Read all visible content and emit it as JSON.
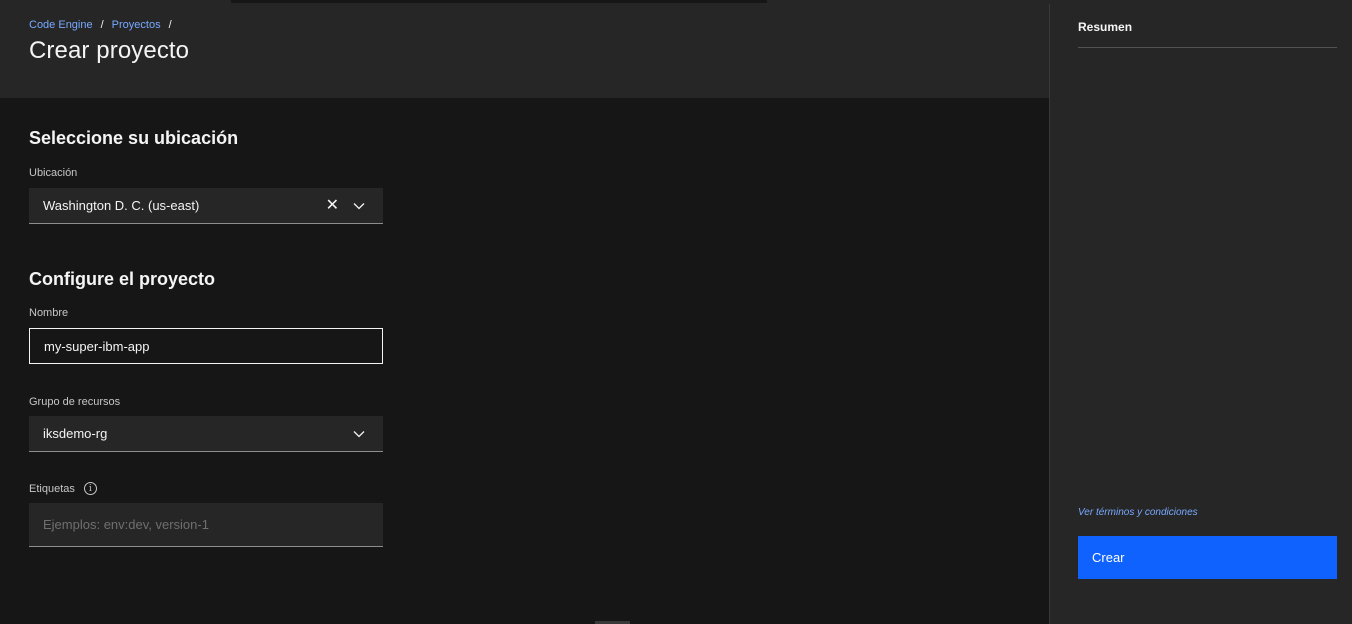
{
  "breadcrumb": {
    "items": [
      "Code Engine",
      "Proyectos"
    ],
    "separator": "/"
  },
  "page": {
    "title": "Crear proyecto"
  },
  "location_section": {
    "title": "Seleccione su ubicación",
    "field_label": "Ubicación",
    "selected_value": "Washington D. C. (us-east)",
    "clear_icon": "close-icon",
    "dropdown_icon": "chevron-down-icon"
  },
  "project_section": {
    "title": "Configure el proyecto",
    "name_label": "Nombre",
    "name_value": "my-super-ibm-app",
    "resource_group_label": "Grupo de recursos",
    "resource_group_value": "iksdemo-rg",
    "tags_label": "Etiquetas",
    "tags_info_icon": "info-icon",
    "tags_placeholder": "Ejemplos: env:dev, version-1"
  },
  "summary": {
    "title": "Resumen",
    "terms_link": "Ver términos y condiciones",
    "create_button": "Crear"
  },
  "colors": {
    "accent": "#0f62fe",
    "link": "#78a9ff",
    "panel_bg": "#262626",
    "page_bg": "#161616"
  }
}
